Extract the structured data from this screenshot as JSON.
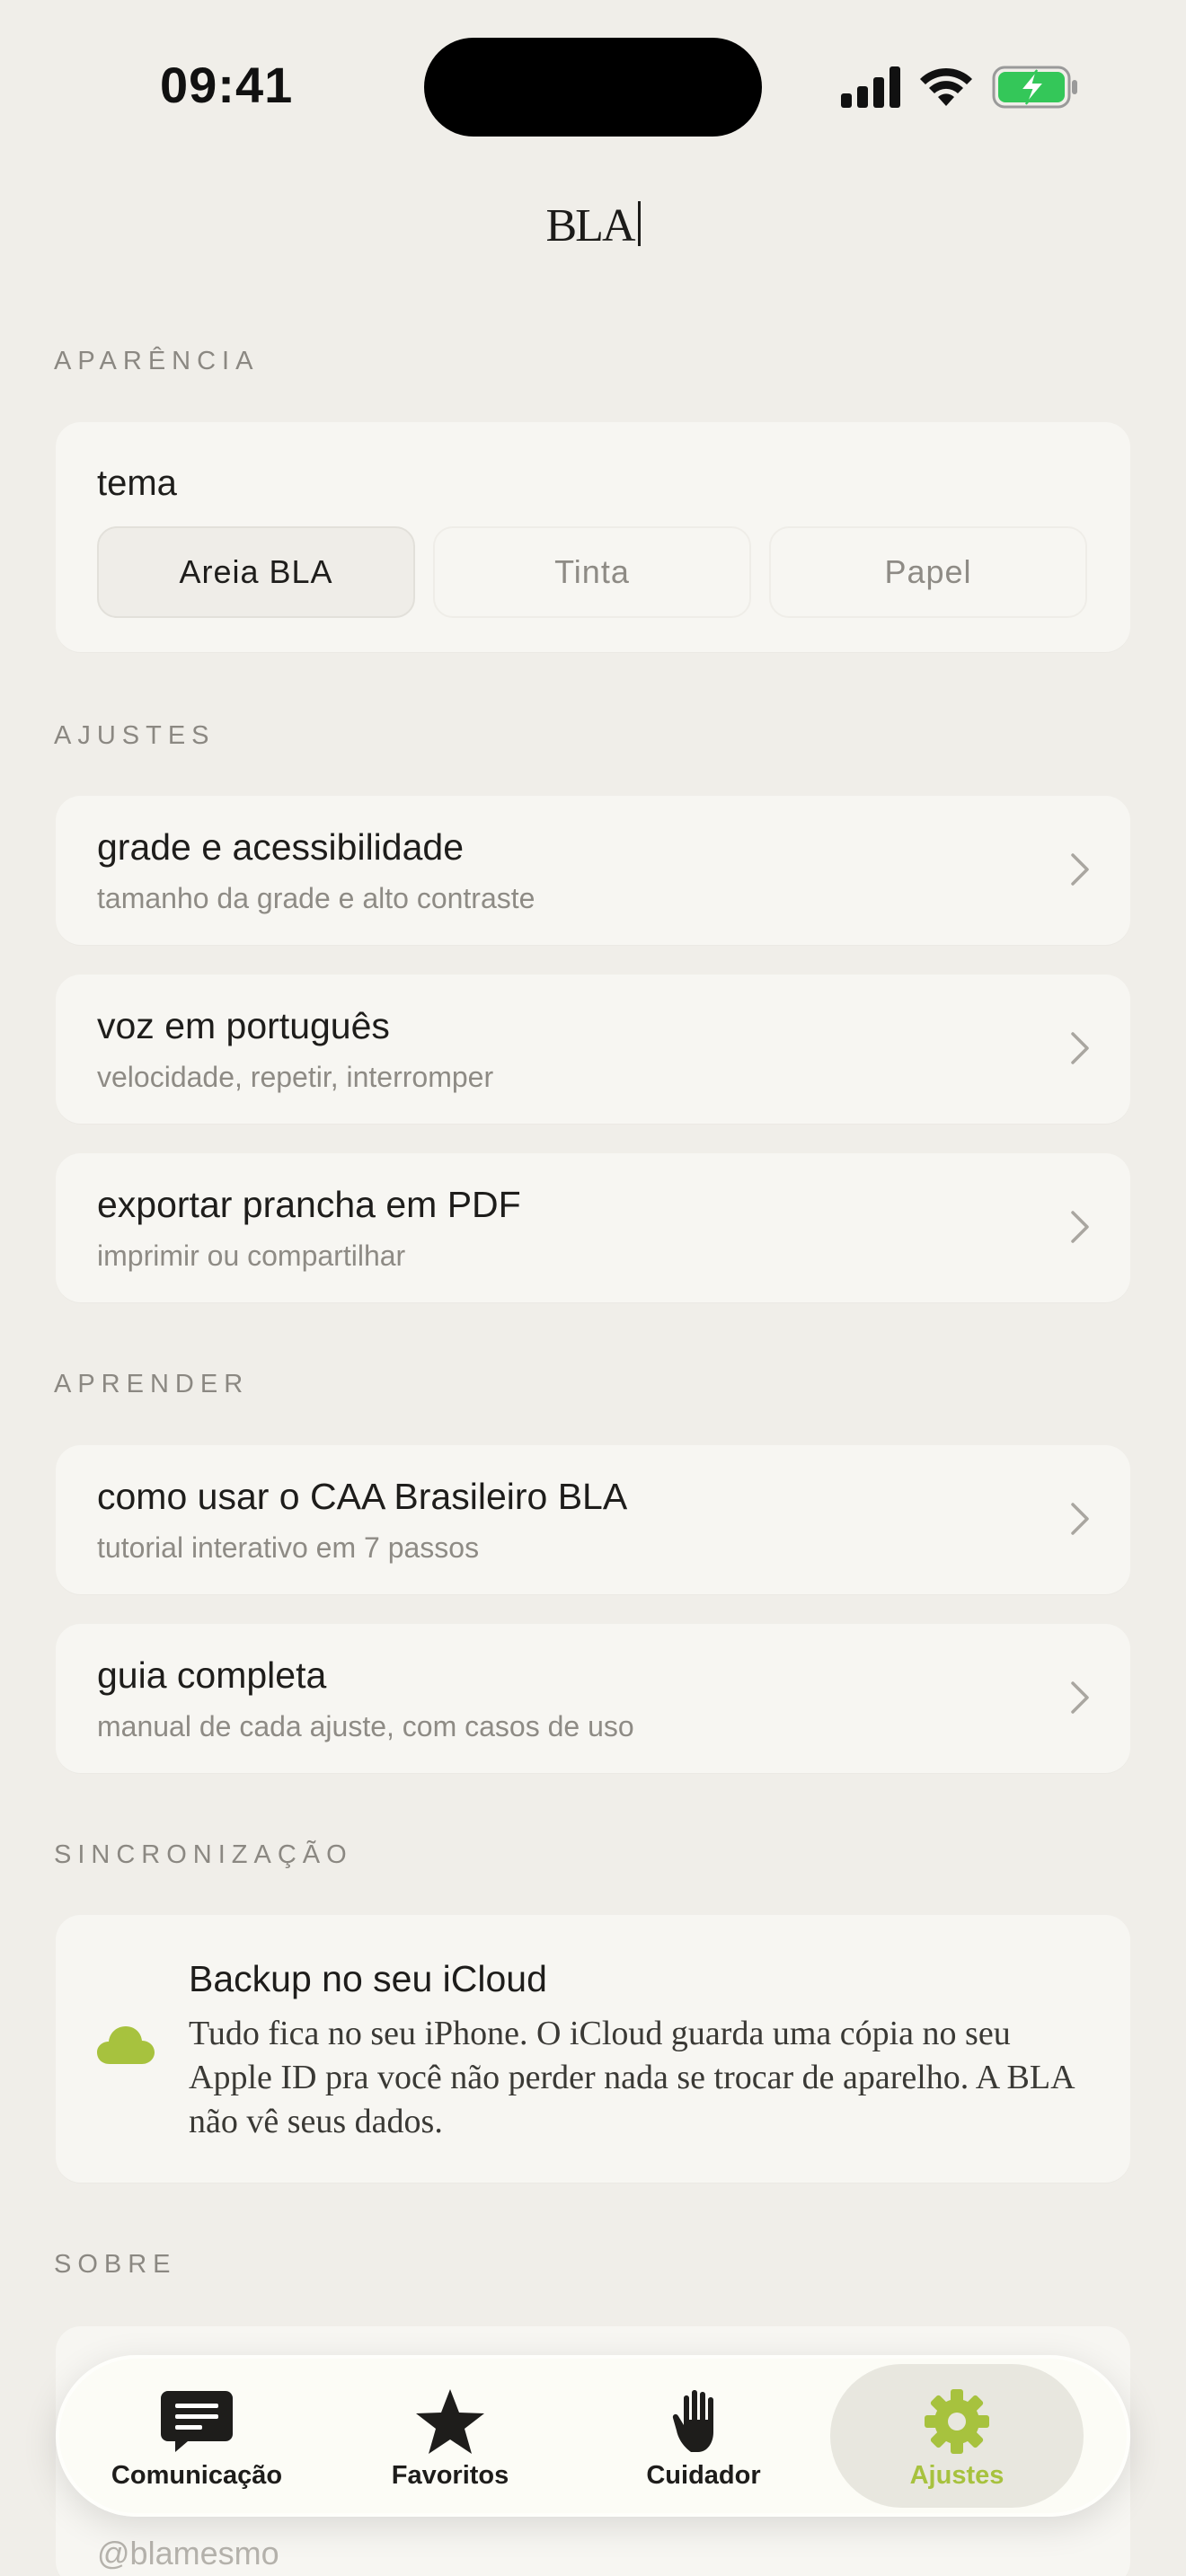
{
  "status": {
    "time": "09:41"
  },
  "app": {
    "logo": "BLA"
  },
  "sections": {
    "appearance": "APARÊNCIA",
    "settings": "AJUSTES",
    "learn": "APRENDER",
    "sync": "SINCRONIZAÇÃO",
    "about": "SOBRE"
  },
  "theme": {
    "title": "tema",
    "options": [
      "Areia BLA",
      "Tinta",
      "Papel"
    ],
    "selected": "Areia BLA"
  },
  "settings_rows": [
    {
      "title": "grade e acessibilidade",
      "subtitle": "tamanho da grade e alto contraste"
    },
    {
      "title": "voz em português",
      "subtitle": "velocidade, repetir, interromper"
    },
    {
      "title": "exportar prancha em PDF",
      "subtitle": "imprimir ou compartilhar"
    }
  ],
  "learn_rows": [
    {
      "title": "como usar o CAA Brasileiro BLA",
      "subtitle": "tutorial interativo em 7 passos"
    },
    {
      "title": "guia completa",
      "subtitle": "manual de cada ajuste, com casos de uso"
    }
  ],
  "backup": {
    "icon": "cloud-icon",
    "title": "Backup no seu iCloud",
    "body": "Tudo fica no seu iPhone. O iCloud guarda uma cópia no seu Apple ID pra você não perder nada se trocar de aparelho. A BLA não vê seus dados."
  },
  "about": {
    "handle": "@blamesmo"
  },
  "tabs": [
    {
      "label": "Comunicação",
      "icon": "chat-bubble-icon"
    },
    {
      "label": "Favoritos",
      "icon": "star-icon"
    },
    {
      "label": "Cuidador",
      "icon": "hand-icon"
    },
    {
      "label": "Ajustes",
      "icon": "gear-icon"
    }
  ],
  "active_tab": "Ajustes",
  "colors": {
    "accent": "#a7c23e",
    "background": "#f0eee9",
    "card": "#f7f6f2",
    "battery": "#34c759"
  }
}
